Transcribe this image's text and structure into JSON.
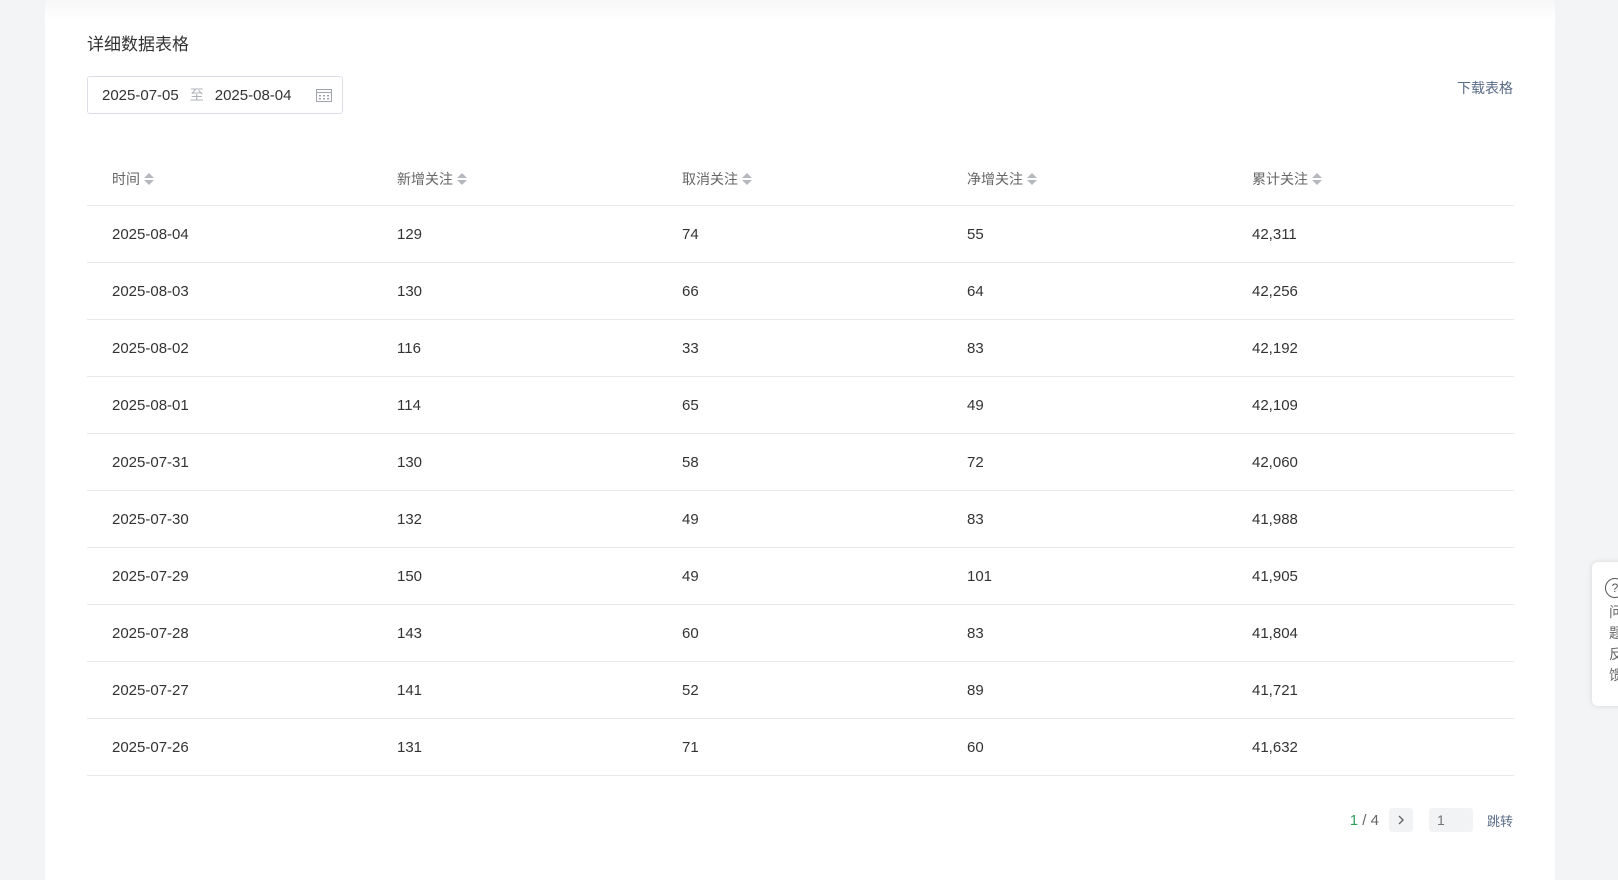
{
  "panel": {
    "title": "详细数据表格",
    "date_start": "2025-07-05",
    "date_separator": "至",
    "date_end": "2025-08-04",
    "download_label": "下载表格"
  },
  "table": {
    "columns": [
      "时间",
      "新增关注",
      "取消关注",
      "净增关注",
      "累计关注"
    ],
    "rows": [
      [
        "2025-08-04",
        "129",
        "74",
        "55",
        "42,311"
      ],
      [
        "2025-08-03",
        "130",
        "66",
        "64",
        "42,256"
      ],
      [
        "2025-08-02",
        "116",
        "33",
        "83",
        "42,192"
      ],
      [
        "2025-08-01",
        "114",
        "65",
        "49",
        "42,109"
      ],
      [
        "2025-07-31",
        "130",
        "58",
        "72",
        "42,060"
      ],
      [
        "2025-07-30",
        "132",
        "49",
        "83",
        "41,988"
      ],
      [
        "2025-07-29",
        "150",
        "49",
        "101",
        "41,905"
      ],
      [
        "2025-07-28",
        "143",
        "60",
        "83",
        "41,804"
      ],
      [
        "2025-07-27",
        "141",
        "52",
        "89",
        "41,721"
      ],
      [
        "2025-07-26",
        "131",
        "71",
        "60",
        "41,632"
      ]
    ]
  },
  "pagination": {
    "current": "1",
    "separator": " / ",
    "total": "4",
    "next_icon": "chevron-right-icon",
    "input_placeholder": "1",
    "jump_label": "跳转"
  },
  "feedback": {
    "icon": "question-circle-icon",
    "label": "问题反馈"
  },
  "colors": {
    "accent_green": "#2f9f5a",
    "link": "#5a6b86"
  }
}
